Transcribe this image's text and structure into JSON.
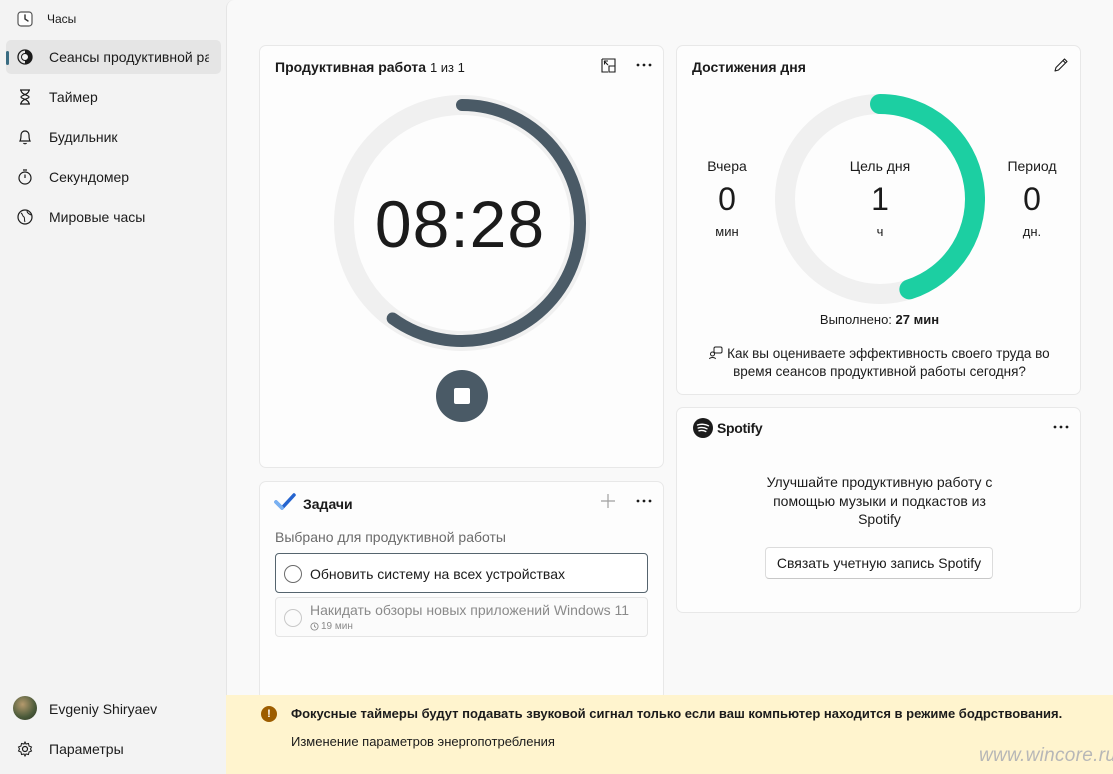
{
  "app": {
    "title": "Часы",
    "icon": "clock-app-icon"
  },
  "window_controls": [
    "minimize",
    "maximize",
    "close"
  ],
  "sidebar": {
    "items": [
      {
        "label": "Сеансы продуктивной работы",
        "icon": "focus-sessions-icon",
        "selected": true
      },
      {
        "label": "Таймер",
        "icon": "hourglass-icon",
        "selected": false
      },
      {
        "label": "Будильник",
        "icon": "bell-icon",
        "selected": false
      },
      {
        "label": "Секундомер",
        "icon": "stopwatch-icon",
        "selected": false
      },
      {
        "label": "Мировые часы",
        "icon": "globe-icon",
        "selected": false
      }
    ],
    "user_name": "Evgeniy Shiryaev",
    "settings_label": "Параметры"
  },
  "focus_card": {
    "title": "Продуктивная работа",
    "session_count": "1 из 1",
    "time": "08:28",
    "progress_remaining_fraction": 0.6,
    "ring_color": "#4a5a66"
  },
  "achievements_card": {
    "title": "Достижения дня",
    "yesterday_label": "Вчера",
    "yesterday_value": "0",
    "yesterday_unit": "мин",
    "goal_label": "Цель дня",
    "goal_value": "1",
    "goal_unit": "ч",
    "streak_label": "Период",
    "streak_value": "0",
    "streak_unit": "дн.",
    "completed_label": "Выполнено:",
    "completed_value": "27 мин",
    "goal_progress_fraction": 0.45,
    "ring_color": "#1ccfa2",
    "feedback_text_line1": "Как вы оцениваете эффективность своего труда во",
    "feedback_text_line2": "время сеансов продуктивной работы сегодня?"
  },
  "tasks_card": {
    "title": "Задачи",
    "subtitle": "Выбрано для продуктивной работы",
    "tasks": [
      {
        "label": "Обновить систему на всех устройствах",
        "selected": true
      },
      {
        "label": "Накидать обзоры новых приложений Windows 11",
        "meta": "19 мин",
        "selected": false
      }
    ]
  },
  "spotify_card": {
    "brand": "Spotify",
    "text_line1": "Улучшайте продуктивную работу с",
    "text_line2": "помощью музыки и подкастов из",
    "text_line3": "Spotify",
    "button_label": "Связать учетную запись Spotify"
  },
  "banner": {
    "title": "Фокусные таймеры будут подавать звуковой сигнал только если ваш компьютер находится в режиме бодрствования.",
    "link": "Изменение параметров энергопотребления",
    "icon": "warning-icon"
  },
  "watermark": "www.wincore.ru"
}
